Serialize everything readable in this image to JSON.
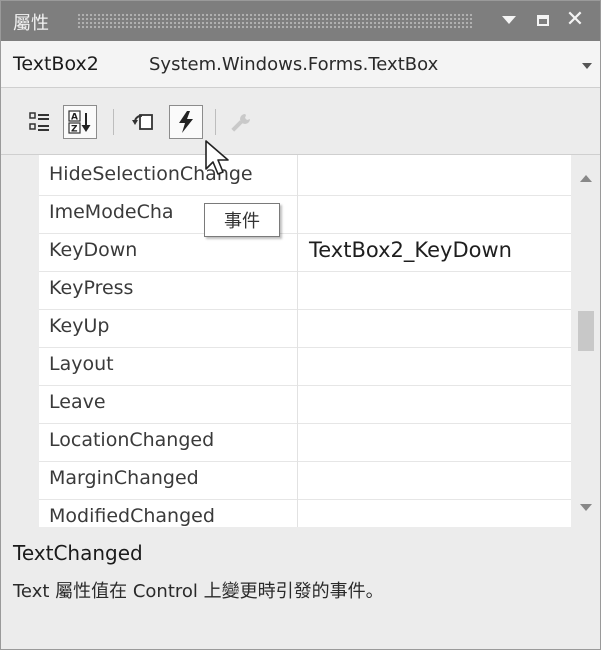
{
  "window": {
    "title": "屬性",
    "buttons": [
      {
        "name": "dropdown",
        "icon": "triangle-down-icon"
      },
      {
        "name": "maximize",
        "icon": "square-icon"
      },
      {
        "name": "close",
        "icon": "close-icon",
        "label": "✕"
      }
    ]
  },
  "object_selector": {
    "name": "TextBox2",
    "type": "System.Windows.Forms.TextBox"
  },
  "toolbar": {
    "buttons": [
      {
        "name": "categorized",
        "icon": "categorized-icon",
        "active": false
      },
      {
        "name": "alphabetical",
        "icon": "sort-az-icon",
        "active": true
      },
      {
        "name": "properties",
        "icon": "property-pages-icon",
        "active": false
      },
      {
        "name": "events",
        "icon": "lightning-icon",
        "active": true
      },
      {
        "name": "property-pages",
        "icon": "wrench-icon",
        "active": false
      }
    ],
    "tooltip": "事件"
  },
  "grid": {
    "rows": [
      {
        "name": "HideSelectionChange",
        "value": ""
      },
      {
        "name": "ImeModeCha",
        "value": ""
      },
      {
        "name": "KeyDown",
        "value": "TextBox2_KeyDown"
      },
      {
        "name": "KeyPress",
        "value": ""
      },
      {
        "name": "KeyUp",
        "value": ""
      },
      {
        "name": "Layout",
        "value": ""
      },
      {
        "name": "Leave",
        "value": ""
      },
      {
        "name": "LocationChanged",
        "value": ""
      },
      {
        "name": "MarginChanged",
        "value": ""
      },
      {
        "name": "ModifiedChanged",
        "value": ""
      }
    ]
  },
  "description": {
    "title": "TextChanged",
    "text": "Text 屬性值在 Control 上變更時引發的事件。"
  },
  "colors": {
    "titlebar": "#7e7e7e",
    "background": "#ececec",
    "grid": "#ffffff"
  }
}
